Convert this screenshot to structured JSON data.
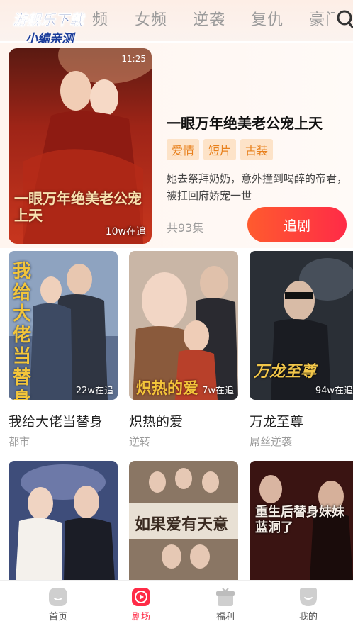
{
  "watermark": {
    "line1": "游舰乐下载",
    "line2": "小编亲测"
  },
  "category_tabs": [
    "频",
    "女频",
    "逆袭",
    "复仇",
    "豪门"
  ],
  "featured": {
    "time": "11:25",
    "poster_title": "一眼万年绝美老公宠上天",
    "views": "10w在追",
    "title": "一眼万年绝美老公宠上天",
    "tags": [
      "爱情",
      "短片",
      "古装"
    ],
    "description": "她去祭拜奶奶，意外撞到喝醉的帝君，被扛回府娇宠一世",
    "episodes": "共93集",
    "follow_label": "追剧"
  },
  "cards": [
    {
      "title": "我给大佬当替身",
      "genre": "都市",
      "views": "22w在追",
      "poster_text": "我给大佬当替身"
    },
    {
      "title": "炽热的爱",
      "genre": "逆转",
      "views": "7w在追",
      "poster_text": "炽热的爱"
    },
    {
      "title": "万龙至尊",
      "genre": "屌丝逆袭",
      "views": "94w在追",
      "poster_text": "万龙至尊"
    },
    {
      "title": "",
      "genre": "",
      "views": "",
      "poster_text": ""
    },
    {
      "title": "",
      "genre": "",
      "views": "",
      "poster_text": "如果爱有天意"
    },
    {
      "title": "",
      "genre": "",
      "views": "",
      "poster_text": "重生后替身妹妹蓝洞了"
    }
  ],
  "bottom_nav": [
    {
      "label": "首页",
      "icon": "home-icon",
      "active": false
    },
    {
      "label": "剧场",
      "icon": "play-icon",
      "active": true
    },
    {
      "label": "福利",
      "icon": "gift-icon",
      "active": false
    },
    {
      "label": "我的",
      "icon": "profile-icon",
      "active": false
    }
  ],
  "colors": {
    "accent": "#ff2b47",
    "tag_bg": "#fde3c8",
    "tag_text": "#e8801c"
  }
}
